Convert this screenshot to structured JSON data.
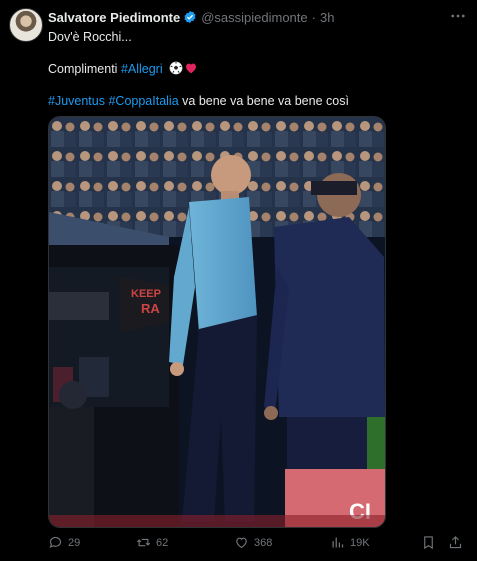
{
  "tweet": {
    "author_name": "Salvatore Piedimonte",
    "handle": "@sassipiedimonte",
    "separator": "·",
    "time": "3h",
    "line1": "Dov'è Rocchi...",
    "line2_text": "Complimenti ",
    "line2_hashtag": "#Allegri",
    "line3_hashtag1": "#Juventus",
    "line3_hashtag2": "#CoppaItalia",
    "line3_text": " va bene va bene va bene così"
  },
  "media": {
    "board_text": "RA",
    "board_text_top": "KEEP",
    "board_text_right": "CI"
  },
  "actions": {
    "replies": "29",
    "reposts": "62",
    "likes": "368",
    "views": "19K"
  },
  "colors": {
    "accent": "#1d9bf0",
    "muted": "#71767b",
    "text": "#e7e9ea",
    "background": "#000000"
  },
  "icons": [
    "verified-icon",
    "more-icon",
    "reply-icon",
    "repost-icon",
    "like-icon",
    "views-icon",
    "bookmark-icon",
    "share-icon",
    "soccer-ball-icon",
    "red-heart-icon"
  ]
}
